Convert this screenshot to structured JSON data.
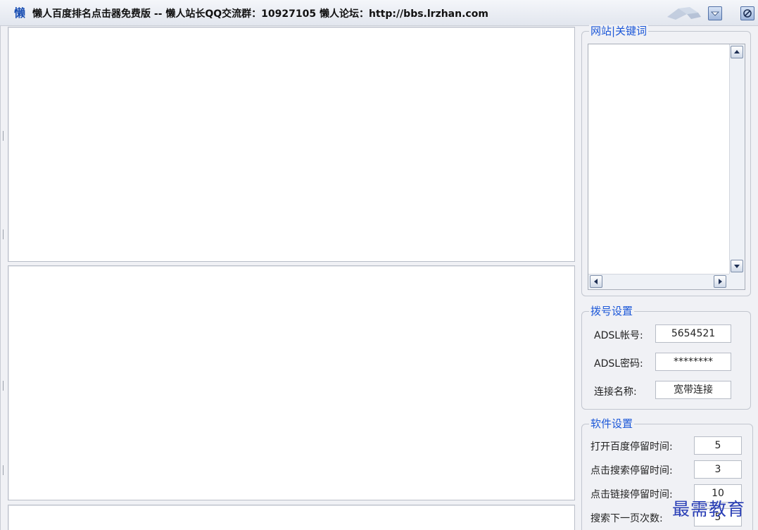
{
  "window": {
    "icon_char": "懒",
    "title": "懒人百度排名点击器免费版 -- 懒人站长QQ交流群：10927105 懒人论坛：http://bbs.lrzhan.com"
  },
  "groups": {
    "keywords": {
      "title": "网站|关键词"
    },
    "dial": {
      "title": "拨号设置",
      "fields": [
        {
          "label": "ADSL帐号:",
          "value": "5654521"
        },
        {
          "label": "ADSL密码:",
          "value": "********"
        },
        {
          "label": "连接名称:",
          "value": "宽带连接"
        }
      ]
    },
    "software": {
      "title": "软件设置",
      "fields": [
        {
          "label": "打开百度停留时间:",
          "value": "5"
        },
        {
          "label": "点击搜索停留时间:",
          "value": "3"
        },
        {
          "label": "点击链接停留时间:",
          "value": "10"
        },
        {
          "label": "搜索下一页次数:",
          "value": "5"
        }
      ]
    }
  },
  "watermark": "最需教育"
}
